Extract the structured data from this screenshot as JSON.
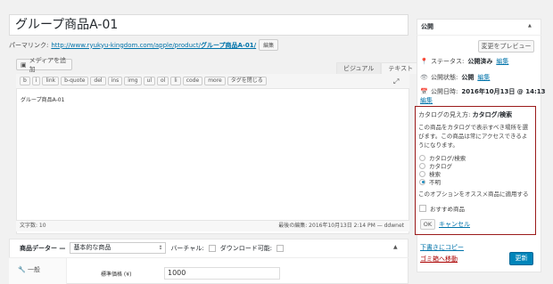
{
  "title": {
    "value": "グループ商品A-01"
  },
  "permalink": {
    "label": "パーマリンク:",
    "url": "http://www.ryukyu-kingdom.com/apple/product/",
    "slug": "グループ商品A-01/",
    "edit": "編集"
  },
  "editor": {
    "media_button": "メディアを追加",
    "tabs": [
      "ビジュアル",
      "テキスト"
    ],
    "quicktags": [
      "b",
      "i",
      "link",
      "b-quote",
      "del",
      "ins",
      "img",
      "ul",
      "ol",
      "li",
      "code",
      "more",
      "タグを閉じる"
    ],
    "content": "グループ商品A-01",
    "word_count": "文字数: 10",
    "last_edited": "最後の編集: 2016年10月13日 2:14 PM — ddwnet"
  },
  "product_data": {
    "label": "商品データー —",
    "type_select": "基本的な商品",
    "virtual_label": "バーチャル:",
    "downloadable_label": "ダウンロード可能:",
    "tab_general": "一般",
    "regular_price_label": "標準価格 (¥)",
    "regular_price_value": "1000"
  },
  "publish": {
    "title": "公開",
    "preview": "変更をプレビュー",
    "status_label": "ステータス:",
    "status_value": "公開済み",
    "status_edit": "編集",
    "visibility_label": "公開状態:",
    "visibility_value": "公開",
    "visibility_edit": "編集",
    "date_label": "公開日時:",
    "date_value": "2016年10月13日 @ 14:13",
    "date_edit": "編集",
    "copy_draft": "下書きにコピー",
    "trash": "ゴミ箱へ移動",
    "update": "更新"
  },
  "catalog": {
    "title_label": "カタログの見え方:",
    "title_value": "カタログ/検索",
    "description": "この商品をカタログで表示すべき場所を選びます。この商品は常にアクセスできるようになります。",
    "options": [
      "カタログ/検索",
      "カタログ",
      "検索",
      "不明"
    ],
    "selected_index": 3,
    "featured_desc": "このオプションをオススメ商品に適用する",
    "featured_label": "おすすめ商品",
    "ok": "OK",
    "cancel": "キャンセル"
  },
  "colors": {
    "link": "#0073aa",
    "highlight_border": "#9b1b1b",
    "primary_button": "#0085ba",
    "trash": "#aa0000"
  }
}
